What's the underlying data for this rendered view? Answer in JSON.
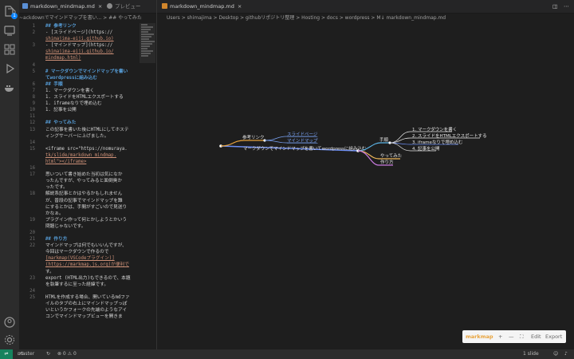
{
  "left_group": {
    "tabs": [
      {
        "label": "markdown_mindmap.md",
        "active": true
      },
      {
        "label": "プレビュー",
        "active": false
      }
    ],
    "breadcrumb": "~ackdownでマインドマップを書い... > ## やってみた",
    "code_lines": [
      {
        "n": "1",
        "t": "## 参考リンク",
        "k": "h"
      },
      {
        "n": "2",
        "t": "- [スライドページ](https://",
        "k": "li"
      },
      {
        "n": "",
        "t": "shimajima-eiji.github.io)",
        "k": "lk"
      },
      {
        "n": "3",
        "t": "- [マインドマップ](https://",
        "k": "li"
      },
      {
        "n": "",
        "t": "shimajima-eiji.github.io/",
        "k": "lk"
      },
      {
        "n": "",
        "t": "mindmap.html)",
        "k": "lk"
      },
      {
        "n": "4",
        "t": "",
        "k": ""
      },
      {
        "n": "5",
        "t": "# マークダウンでマインドマップを書い",
        "k": "h"
      },
      {
        "n": "",
        "t": "てwordpressに組み込む",
        "k": "h"
      },
      {
        "n": "6",
        "t": "## 手順",
        "k": "h"
      },
      {
        "n": "7",
        "t": "1. マークダウンを書く",
        "k": "li"
      },
      {
        "n": "8",
        "t": "1. スライドをHTMLエクスポートする",
        "k": "li"
      },
      {
        "n": "9",
        "t": "1. iframeなりで埋め込む",
        "k": "li"
      },
      {
        "n": "10",
        "t": "1. 記事を公開",
        "k": "li"
      },
      {
        "n": "11",
        "t": "",
        "k": ""
      },
      {
        "n": "12",
        "t": "## やってみた",
        "k": "h"
      },
      {
        "n": "13",
        "t": "この記事を書いた後にHTMLにしてホステ",
        "k": ""
      },
      {
        "n": "",
        "t": "ィングサーバーに上げました。",
        "k": ""
      },
      {
        "n": "14",
        "t": "",
        "k": ""
      },
      {
        "n": "15",
        "t": "<iframe src=\"https://nomuraya.",
        "k": "li"
      },
      {
        "n": "",
        "t": "tk/slide/markdown_mindmap.",
        "k": "lk"
      },
      {
        "n": "",
        "t": "html\"></iframe>",
        "k": "lk"
      },
      {
        "n": "16",
        "t": "",
        "k": ""
      },
      {
        "n": "17",
        "t": "思いついて書き始めた当初は気になか",
        "k": ""
      },
      {
        "n": "",
        "t": "ったんですが、やってみると面倒臭か",
        "k": ""
      },
      {
        "n": "",
        "t": "ったです。",
        "k": ""
      },
      {
        "n": "18",
        "t": "解説系記事とかはやるかもしれません",
        "k": ""
      },
      {
        "n": "",
        "t": "が、普段の記事でマインドマップを難",
        "k": ""
      },
      {
        "n": "",
        "t": "にするとかは、手間がすごいので見送り",
        "k": ""
      },
      {
        "n": "",
        "t": "かなぁ。",
        "k": ""
      },
      {
        "n": "19",
        "t": "プラグイン作って何とかしようとかいう",
        "k": ""
      },
      {
        "n": "",
        "t": "問題じゃないです。",
        "k": ""
      },
      {
        "n": "20",
        "t": "",
        "k": ""
      },
      {
        "n": "21",
        "t": "## 作り方",
        "k": "h"
      },
      {
        "n": "22",
        "t": "マインドマップは何でもいいんですが、",
        "k": ""
      },
      {
        "n": "",
        "t": "今回はマークダウンで作るので",
        "k": ""
      },
      {
        "n": "",
        "t": "[markmap(VSCodeプラグイン)]",
        "k": "lk"
      },
      {
        "n": "",
        "t": "(https://markmap.js.org)が便利で",
        "k": "lk"
      },
      {
        "n": "",
        "t": "す。",
        "k": ""
      },
      {
        "n": "23",
        "t": "export (HTML出力)もできるので、本題",
        "k": ""
      },
      {
        "n": "",
        "t": "を執筆するに至った経緯です。",
        "k": ""
      },
      {
        "n": "24",
        "t": "",
        "k": ""
      },
      {
        "n": "25",
        "t": "HTMLを作成する場合、開いているmdファ",
        "k": ""
      },
      {
        "n": "",
        "t": "イルのタブの右上にマインドマップっぽ",
        "k": ""
      },
      {
        "n": "",
        "t": "いというかフォークの先端のようなアイ",
        "k": ""
      },
      {
        "n": "",
        "t": "コンでマインドマップビューを開きま",
        "k": ""
      }
    ]
  },
  "right_group": {
    "tab": {
      "label": "markdown_mindmap.md"
    },
    "breadcrumb": "Users > shimajima > Desktop > githubリポジトリ整理 > Hosting > docs > wordpress > M↓ markdown_mindmap.md"
  },
  "mindmap": {
    "root": "マークダウンでマインドマップを書いてwordpressに組み込む",
    "branches": [
      {
        "label": "参考リンク",
        "color": "#e8a33c",
        "children": [
          "スライドページ",
          "マインドマップ"
        ],
        "child_color": "#7aa3f5"
      },
      {
        "label": "手順",
        "color": "#5bb4e6",
        "children": [
          "1. マークダウンを書く",
          "2. スライドをHTMLエクスポートする",
          "3. iframeなりで埋め込む",
          "4. 記事を公開"
        ],
        "child_color": "#e6e6e6"
      },
      {
        "label": "やってみた",
        "color": "#f0b85a",
        "children": [],
        "child_color": ""
      },
      {
        "label": "作り方",
        "color": "#c97ae0",
        "children": [],
        "child_color": ""
      }
    ]
  },
  "mm_toolbar": {
    "logo": "markmap",
    "plus": "+",
    "minus": "—",
    "fit": "⛶",
    "edit": "Edit",
    "export": "Export"
  },
  "status": {
    "branch": "master",
    "sync": "↻",
    "errors": "⊗ 0 ⚠ 0",
    "slides": "1 slide"
  }
}
